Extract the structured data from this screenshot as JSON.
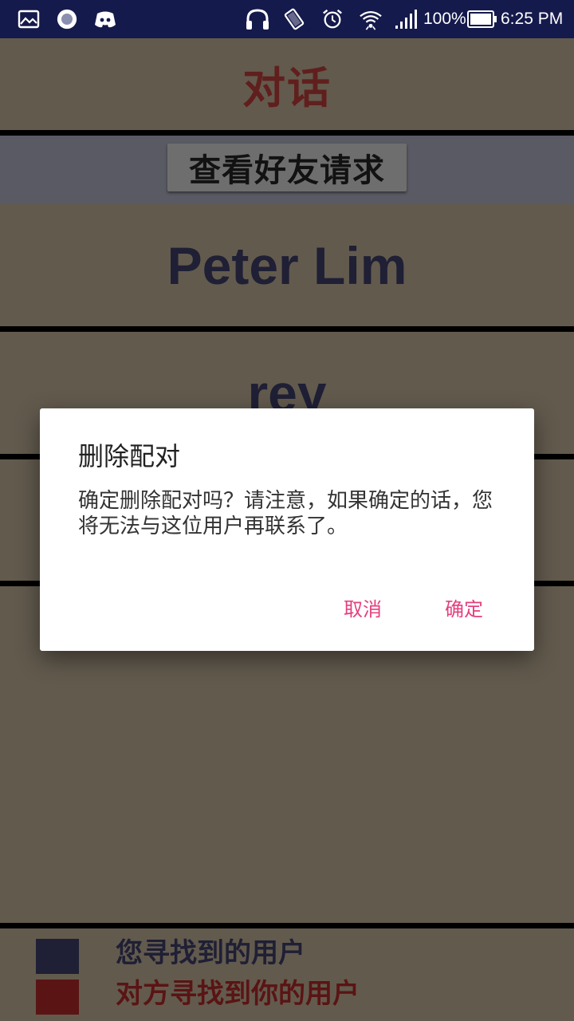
{
  "status_bar": {
    "left_icons": [
      "image-icon",
      "record-icon",
      "discord-icon"
    ],
    "right_icons": [
      "headphones-icon",
      "auto-rotate-icon",
      "alarm-icon",
      "wifi-icon",
      "signal-icon"
    ],
    "battery": "100%",
    "time": "6:25 PM"
  },
  "header": {
    "title": "对话"
  },
  "friend_requests": {
    "label": "查看好友请求"
  },
  "conversations": [
    {
      "name": "Peter Lim"
    },
    {
      "name": "rey"
    }
  ],
  "legend": [
    {
      "label": "您寻找到的用户",
      "color": "#1f1f35"
    },
    {
      "label": "对方寻找到你的用户",
      "color": "#5a1414"
    }
  ],
  "dialog": {
    "title": "删除配对",
    "message": "确定删除配对吗？请注意，如果确定的话，您将无法与这位用户再联系了。",
    "cancel_label": "取消",
    "confirm_label": "确定"
  },
  "colors": {
    "accent": "#e53f7d",
    "status_bar": "#151a4c",
    "scrim_background": "#625a4d"
  }
}
